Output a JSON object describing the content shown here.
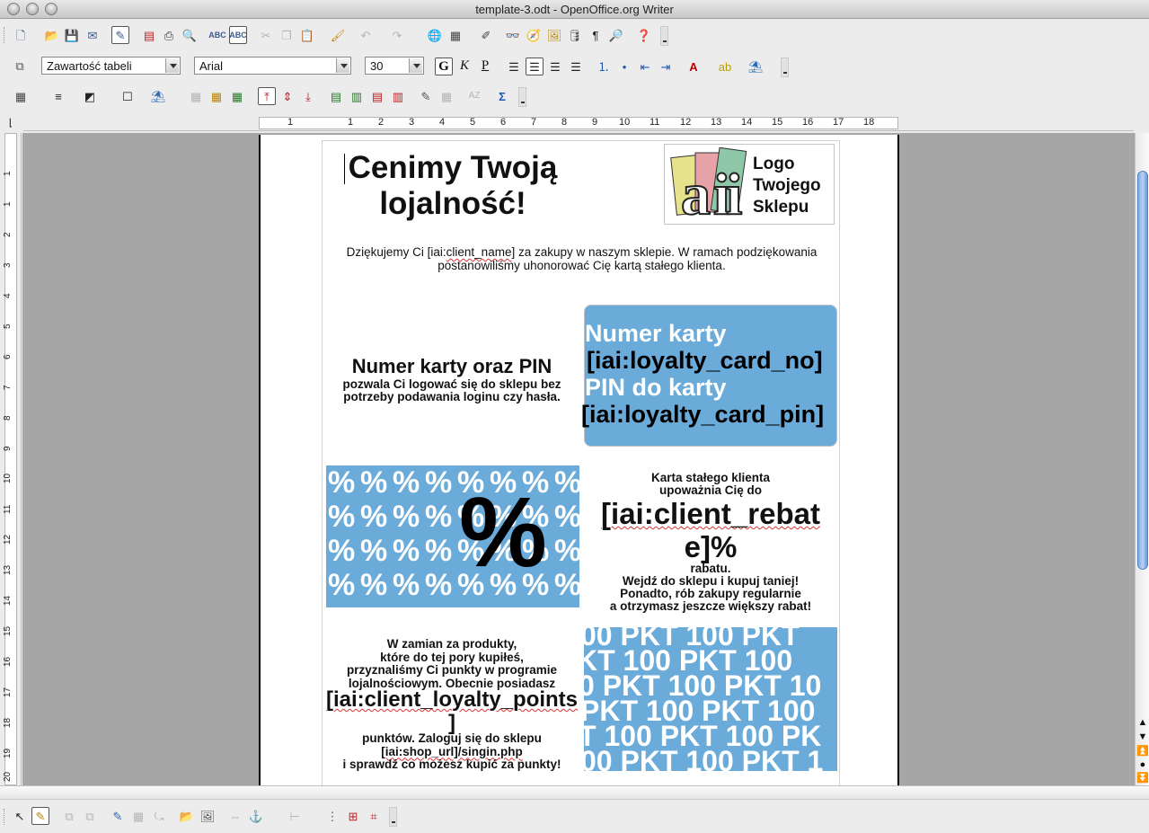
{
  "window": {
    "title": "template-3.odt - OpenOffice.org Writer"
  },
  "format_bar": {
    "paragraph_style": "Zawartość tabeli",
    "font_name": "Arial",
    "font_size": "30",
    "bold_label": "G",
    "italic_label": "K",
    "underline_label": "P"
  },
  "ruler": {
    "h_ticks": [
      "1",
      "1",
      "2",
      "3",
      "4",
      "5",
      "6",
      "7",
      "8",
      "9",
      "10",
      "11",
      "12",
      "13",
      "14",
      "15",
      "16",
      "17",
      "18"
    ],
    "v_ticks": [
      "1",
      "1",
      "2",
      "3",
      "4",
      "5",
      "6",
      "7",
      "8",
      "9",
      "10",
      "11",
      "12",
      "13",
      "14",
      "15",
      "16",
      "17",
      "18",
      "19",
      "20"
    ]
  },
  "document": {
    "title_line1": "Cenimy Twoją",
    "title_line2": "lojalność!",
    "logo_line1": "Logo",
    "logo_line2": "Twojego",
    "logo_line3": "Sklepu",
    "thanks_a": "Dziękujemy Ci [iai:",
    "thanks_spell": "client_name",
    "thanks_b": "] za zakupy w naszym sklepie. W ramach podziękowania",
    "thanks_line2": "postanowiliśmy uhonorować Cię kartą stałego klienta.",
    "card_heading": "Numer karty oraz PIN",
    "card_sub1": "pozwala Ci logować się do sklepu bez",
    "card_sub2": "potrzeby podawania loginu czy hasła.",
    "blue_label1": "Numer karty",
    "blue_value1": "[iai:loyalty_card_no]",
    "blue_label2": "PIN do karty",
    "blue_value2": "[iai:loyalty_card_pin]",
    "percent_glyph": "%",
    "rebate_line1": "Karta stałego klienta",
    "rebate_line2": "upoważnia Cię do",
    "rebate_big1": "[iai:client_rebat",
    "rebate_big2": "e]%",
    "rebate_after1": "rabatu.",
    "rebate_after2": "Wejdź do sklepu i kupuj taniej!",
    "rebate_after3": "Ponadto, rób zakupy regularnie",
    "rebate_after4": "a otrzymasz jeszcze większy rabat!",
    "points_line1": "W zamian za produkty,",
    "points_line2": "które do tej pory kupiłeś,",
    "points_line3": "przyznaliśmy Ci punkty w programie",
    "points_line4": "lojalnościowym. Obecnie posiadasz",
    "points_big1": "[iai:client_loyalty_points",
    "points_big2": "]",
    "points_after1": "punktów. Zaloguj się do sklepu",
    "points_after2": "[iai:shop_url]/singin.php",
    "points_after3": "i sprawdź co możesz kupić za punkty!",
    "pkt_line1": "00 PKT 100 PKT",
    "pkt_line2": "KT 100 PKT 100",
    "pkt_line3": "0 PKT 100 PKT 10",
    "pkt_line4": "PKT 100 PKT 100",
    "pkt_line5": "T 100 PKT 100 PK",
    "pkt_line6": "00 PKT 100 PKT 1"
  }
}
